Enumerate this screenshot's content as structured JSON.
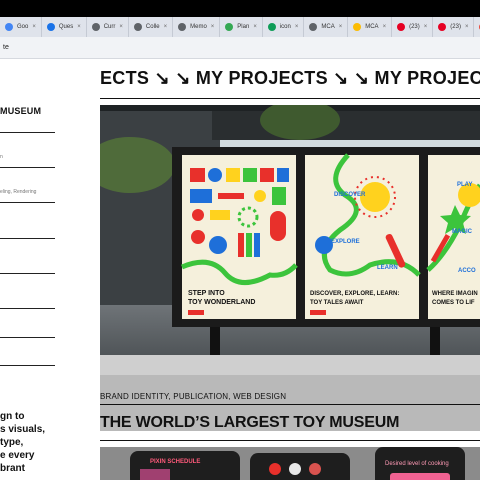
{
  "browser": {
    "tabs": [
      {
        "label": "Goo",
        "color": "#4285f4"
      },
      {
        "label": "Ques",
        "color": "#1a73e8"
      },
      {
        "label": "Curr",
        "color": "#5f6368"
      },
      {
        "label": "Colle",
        "color": "#5f6368"
      },
      {
        "label": "Memo",
        "color": "#5f6368"
      },
      {
        "label": "Plan",
        "color": "#34a853"
      },
      {
        "label": "icon",
        "color": "#0f9d58"
      },
      {
        "label": "MCA",
        "color": "#5f6368"
      },
      {
        "label": "MCA",
        "color": "#fbbc04"
      },
      {
        "label": "(23)",
        "color": "#e60023"
      },
      {
        "label": "(23)",
        "color": "#e60023"
      },
      {
        "label": "Inbox",
        "color": "#ea4335"
      },
      {
        "label": "控制",
        "color": "#e0583a"
      }
    ],
    "address_fragment": "te"
  },
  "sidebar": {
    "title": "MUSEUM",
    "small_1": "n",
    "small_2": "eling, Rendering",
    "description_lines": [
      "gn to",
      "s visuals,",
      "type,",
      "e every",
      "brant"
    ]
  },
  "main": {
    "marquee": "ECTS ↘ ↘  MY PROJECTS ↘ ↘ MY PROJECTS ↘ ↘",
    "tags": "BRAND IDENTITY, PUBLICATION, WEB DESIGN",
    "project_title": "THE WORLD’S LARGEST TOY MUSEUM",
    "posters": [
      {
        "headline_1": "STEP INTO",
        "headline_2": "TOY WONDERLAND"
      },
      {
        "headline_1": "DISCOVER, EXPLORE, LEARN:",
        "headline_2": "TOY TALES AWAIT",
        "words": [
          "DISCOVER",
          "EXPLORE",
          "LEARN"
        ]
      },
      {
        "headline_1": "WHERE IMAGIN",
        "headline_2": "COMES TO LIF",
        "words": [
          "PLAY",
          "MAGIC",
          "ACCO"
        ]
      }
    ],
    "preview": {
      "left_label": "PIXIN SCHEDULE",
      "right_label": "Desired level of cooking"
    }
  },
  "colors": {
    "poster_bg": "#f5f0dc",
    "green_path": "#3cc43c",
    "red": "#e8302b",
    "blue": "#1e6fd9",
    "yellow": "#ffd21e",
    "billboard": "#1b1b1b"
  }
}
